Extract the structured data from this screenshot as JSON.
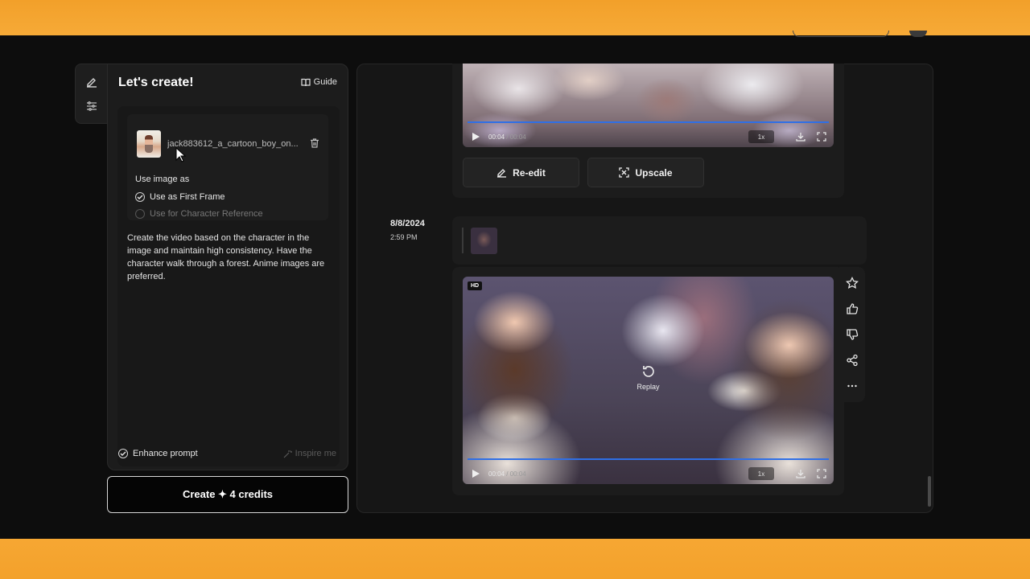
{
  "panel": {
    "title": "Let's create!",
    "guide_label": "Guide",
    "file_name": "jack883612_a_cartoon_boy_on...",
    "use_image_as": "Use image as",
    "option_first_frame": "Use as First Frame",
    "option_character_ref": "Use for Character Reference",
    "prompt_text": "Create the video based on the character in the image and maintain high consistency. Have the character walk through a forest. Anime images are preferred.",
    "enhance_label": "Enhance prompt",
    "inspire_label": "Inspire me",
    "create_label": "Create ✦ 4 credits"
  },
  "feed": {
    "video1": {
      "time_current": "00:04",
      "time_total": "/ 00:04",
      "speed": "1x",
      "progress": 1.0
    },
    "reedit_label": "Re-edit",
    "upscale_label": "Upscale",
    "date": "8/8/2024",
    "time": "2:59 PM",
    "video2": {
      "badge": "HD",
      "replay_label": "Replay",
      "time_current": "00:04",
      "time_total": "/ 00:04",
      "speed": "1x",
      "progress": 1.0
    }
  },
  "colors": {
    "accent_band": "#f5a62f",
    "progress": "#2f6fe6",
    "background": "#0d0d0d"
  },
  "icons": [
    "edit-icon",
    "sliders-icon",
    "book-icon",
    "trash-icon",
    "check-circle-icon",
    "wand-icon",
    "play-icon",
    "download-icon",
    "fullscreen-icon",
    "pen-icon",
    "expand-icon",
    "replay-icon",
    "star-icon",
    "thumbs-up-icon",
    "thumbs-down-icon",
    "share-icon",
    "more-icon"
  ]
}
